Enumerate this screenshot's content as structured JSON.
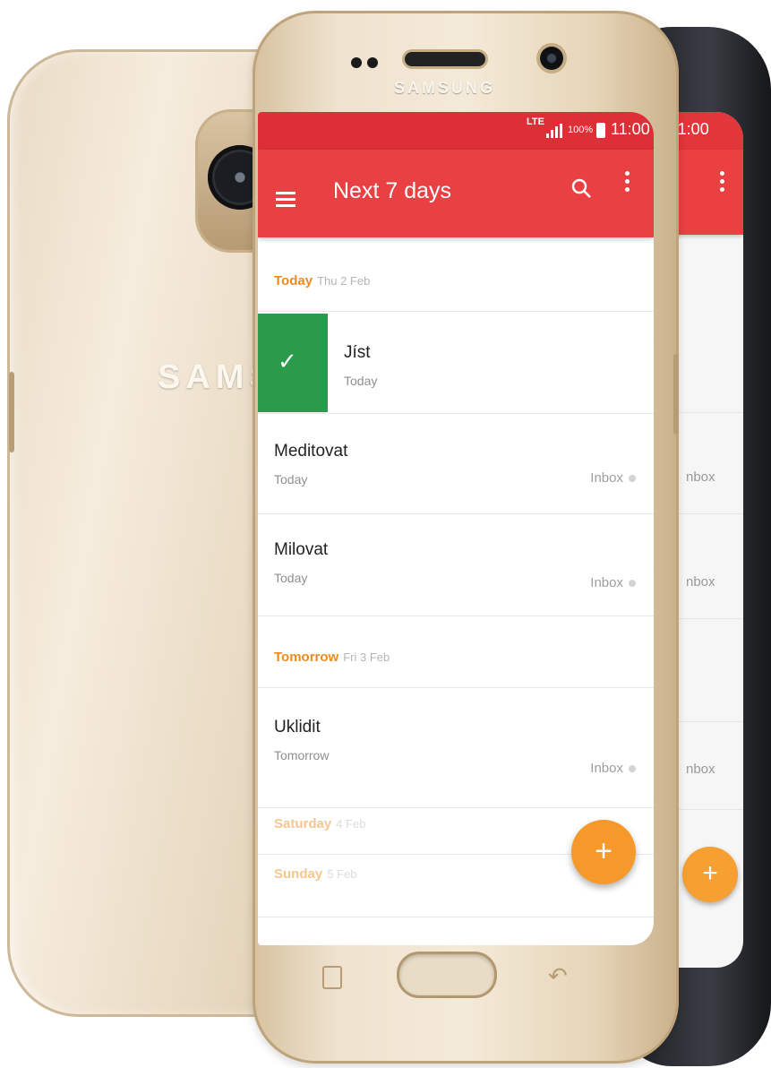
{
  "device": {
    "brand": "SAMSUNG",
    "back_brand": "SAMS"
  },
  "statusbar": {
    "network": "LTE",
    "battery": "100%",
    "time": "11:00"
  },
  "appbar": {
    "title": "Next 7 days",
    "icons": [
      "menu-icon",
      "search-icon",
      "more-vert-icon"
    ]
  },
  "sections": [
    {
      "day": "Today",
      "date": "Thu 2 Feb",
      "tasks": [
        {
          "title": "Jíst",
          "due": "Today",
          "project": "",
          "completed_swipe": true
        },
        {
          "title": "Meditovat",
          "due": "Today",
          "project": "Inbox"
        },
        {
          "title": "Milovat",
          "due": "Today",
          "project": "Inbox"
        }
      ]
    },
    {
      "day": "Tomorrow",
      "date": "Fri 3 Feb",
      "tasks": [
        {
          "title": "Uklidit",
          "due": "Tomorrow",
          "project": "Inbox"
        }
      ]
    },
    {
      "day": "Saturday",
      "date": "4 Feb",
      "tasks": []
    },
    {
      "day": "Sunday",
      "date": "5 Feb",
      "tasks": []
    }
  ],
  "fab": {
    "label": "+"
  },
  "second_phone": {
    "battery": "%",
    "time": "11:00",
    "project_labels": [
      "nbox",
      "nbox",
      "nbox"
    ],
    "fab_label": "+"
  },
  "colors": {
    "statusbar": "#dd2f35",
    "appbar": "#e94043",
    "today_header": "#f08a1c",
    "tomorrow_header": "#f08a1c",
    "weekend_header": "#f7c68f",
    "swipe_complete": "#2a9b4a",
    "fab": "#f59a2a",
    "project_dot": "#d4d4d4"
  }
}
